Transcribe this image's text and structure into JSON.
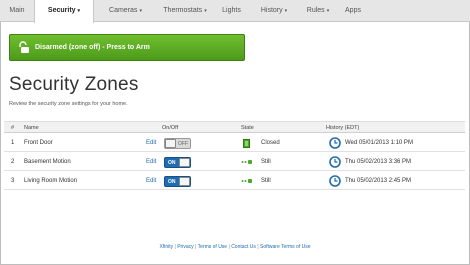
{
  "nav": {
    "items": [
      {
        "label": "Main"
      },
      {
        "label": "Security",
        "caret": "▾"
      },
      {
        "label": "Cameras",
        "caret": "▾"
      },
      {
        "label": "Thermostats",
        "caret": "▾"
      },
      {
        "label": "Lights"
      },
      {
        "label": "History",
        "caret": "▾"
      },
      {
        "label": "Rules",
        "caret": "▾"
      },
      {
        "label": "Apps"
      }
    ],
    "active": "Security"
  },
  "arm_button": {
    "label": "Disarmed (zone off) - Press to Arm",
    "icon": "unlocked-padlock-icon"
  },
  "page": {
    "title": "Security Zones",
    "subtitle": "Review the security zone settings for your home."
  },
  "table": {
    "headers": {
      "num": "#",
      "name": "Name",
      "onoff": "On/Off",
      "state": "State",
      "history": "History (EDT)"
    },
    "rows": [
      {
        "num": "1",
        "name": "Front Door",
        "edit": "Edit",
        "toggle": "OFF",
        "state": "Closed",
        "state_icon": "door-closed-icon",
        "history": "Wed 05/01/2013 1:10 PM"
      },
      {
        "num": "2",
        "name": "Basement Motion",
        "edit": "Edit",
        "toggle": "ON",
        "state": "Still",
        "state_icon": "motion-still-icon",
        "history": "Thu 05/02/2013 3:36 PM"
      },
      {
        "num": "3",
        "name": "Living Room Motion",
        "edit": "Edit",
        "toggle": "ON",
        "state": "Still",
        "state_icon": "motion-still-icon",
        "history": "Thu 05/02/2013 2:45 PM"
      }
    ]
  },
  "footer": {
    "links": [
      "Xfinity",
      "Privacy",
      "Terms of Use",
      "Contact Us",
      "Software Terms of Use"
    ],
    "separator": "|"
  },
  "colors": {
    "accent_green": "#5aab22",
    "link_blue": "#1f6cb3",
    "state_green": "#4aa82a"
  }
}
